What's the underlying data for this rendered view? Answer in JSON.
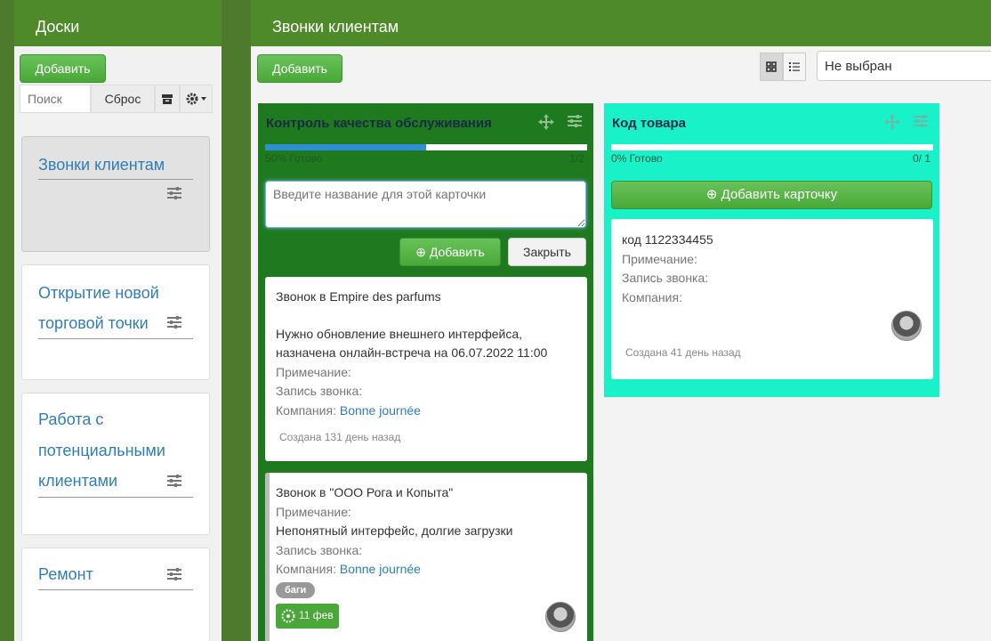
{
  "sidebar": {
    "title": "Доски",
    "add_label": "Добавить",
    "search_placeholder": "Поиск",
    "reset_label": "Сброс",
    "boards": [
      {
        "line1": "Звонки клиентам",
        "line2": "",
        "line3": ""
      },
      {
        "line1": "Открытие новой",
        "line2": "торговой точки",
        "line3": ""
      },
      {
        "line1": "Работа с",
        "line2": "потенциальными",
        "line3": "клиентами"
      },
      {
        "line1": "Ремонт",
        "line2": "",
        "line3": ""
      }
    ]
  },
  "main": {
    "title": "Звонки клиентам",
    "add_label": "Добавить",
    "select_value": "Не выбран"
  },
  "columns": [
    {
      "title": "Контроль качества обслуживания",
      "progress_text": "50% Готово",
      "progress_value": 0.5,
      "count": "1/2",
      "textarea_placeholder": "Введите название для этой карточки",
      "add_label": "Добавить",
      "close_label": "Закрыть",
      "cards": [
        {
          "title": "Звонок в Empire des parfums",
          "desc1": "Нужно обновление внешнего интерфейса,",
          "desc2": "назначена онлайн-встреча на 06.07.2022 11:00",
          "note_label": "Примечание:",
          "record_label": "Запись звонка:",
          "company_label": "Компания:",
          "company": "Bonne journée",
          "created": "Создана 131 день назад"
        },
        {
          "title": "Звонок в \"ООО Рога и Копыта\"",
          "note_label": "Примечание:",
          "note": "Непонятный интерфейс, долгие загрузки",
          "record_label": "Запись звонка:",
          "company_label": "Компания:",
          "company": "Bonne journée",
          "tag": "баги",
          "date": "11 фев"
        }
      ]
    },
    {
      "title": "Код товара",
      "progress_text": "0% Готово",
      "progress_value": 0,
      "count": "0/ 1",
      "add_card_label": "Добавить карточку",
      "cards": [
        {
          "title": "код 1122334455",
          "note_label": "Примечание:",
          "record_label": "Запись звонка:",
          "company_label": "Компания:",
          "created": "Создана 41 день назад"
        }
      ]
    }
  ],
  "colors": {
    "header": "#4f8a2a",
    "column1": "#1f7a1f",
    "column2": "#19f2c8",
    "accent_link": "#2f7fb5",
    "button_green": "#49a838"
  }
}
